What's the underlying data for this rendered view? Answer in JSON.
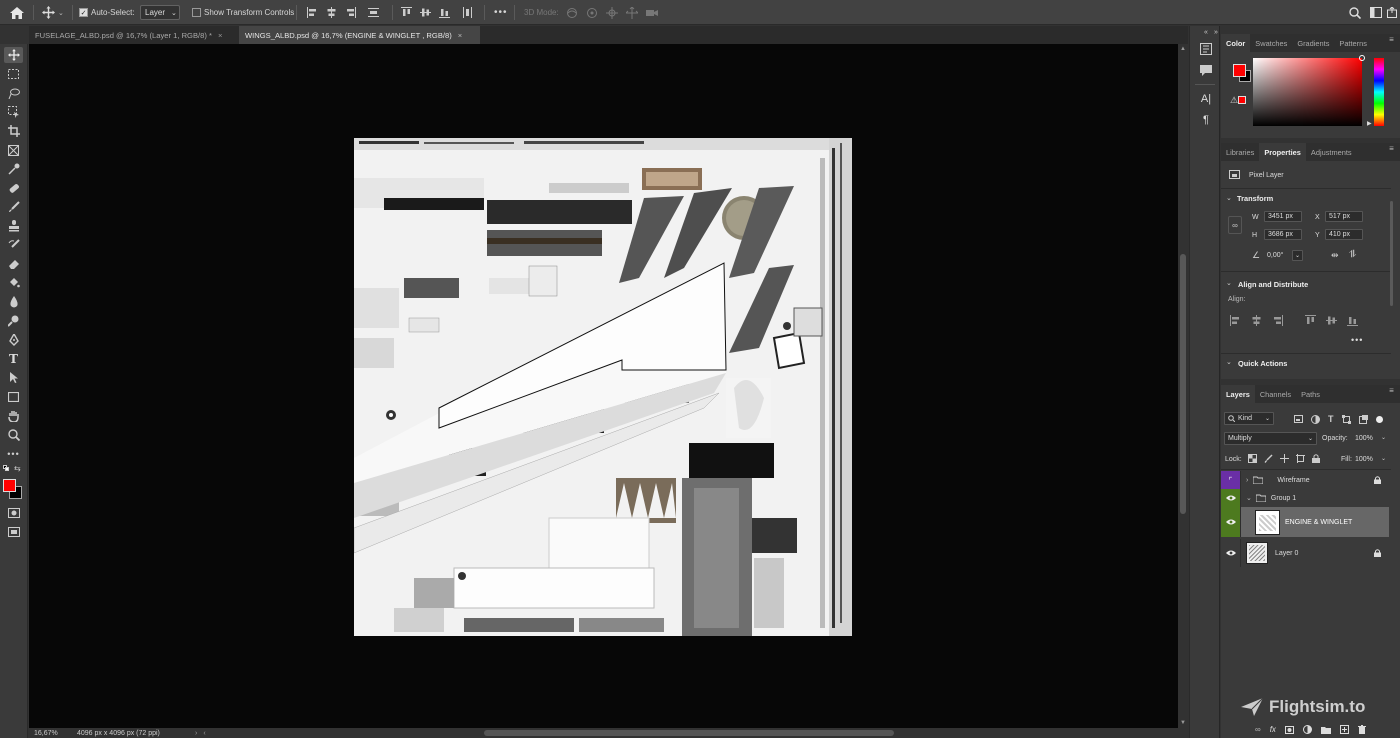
{
  "options_bar": {
    "auto_select_label": "Auto-Select:",
    "auto_select_target": "Layer",
    "show_transform_label": "Show Transform Controls",
    "more_label": "•••",
    "mode_3d_label": "3D Mode:"
  },
  "doc_tabs": [
    {
      "title": "FUSELAGE_ALBD.psd @ 16,7% (Layer 1, RGB/8) *",
      "active": false
    },
    {
      "title": "WINGS_ALBD.psd @ 16,7% (ENGINE & WINGLET , RGB/8)",
      "active": true
    }
  ],
  "status_bar": {
    "zoom": "16,67%",
    "doc_info": "4096 px x 4096 px (72 ppi)"
  },
  "color_panel": {
    "tabs": [
      "Color",
      "Swatches",
      "Gradients",
      "Patterns"
    ],
    "active_tab": "Color",
    "foreground": "#ff0000",
    "background": "#000000"
  },
  "properties_panel": {
    "tabs": [
      "Libraries",
      "Properties",
      "Adjustments"
    ],
    "active_tab": "Properties",
    "layer_type": "Pixel Layer",
    "transform_label": "Transform",
    "w_label": "W",
    "w_value": "3451 px",
    "h_label": "H",
    "h_value": "3686 px",
    "x_label": "X",
    "x_value": "517 px",
    "y_label": "Y",
    "y_value": "410 px",
    "angle_value": "0,00°",
    "align_distribute_label": "Align and Distribute",
    "align_label": "Align:",
    "quick_actions_label": "Quick Actions"
  },
  "layers_panel": {
    "tabs": [
      "Layers",
      "Channels",
      "Paths"
    ],
    "active_tab": "Layers",
    "filter_kind": "Kind",
    "blend_mode": "Multiply",
    "opacity_label": "Opacity:",
    "opacity_value": "100%",
    "lock_label": "Lock:",
    "fill_label": "Fill:",
    "fill_value": "100%",
    "layers": [
      {
        "name": "Wireframe",
        "visible": false,
        "type": "group",
        "locked": true
      },
      {
        "name": "Group 1",
        "visible": true,
        "type": "group",
        "locked": false
      },
      {
        "name": "ENGINE & WINGLET",
        "visible": true,
        "type": "pixel",
        "selected": true
      },
      {
        "name": "Layer 0",
        "visible": true,
        "type": "pixel",
        "locked": true
      }
    ]
  },
  "watermark": "Flightsim.to",
  "colors": {
    "accent_green": "#4d7a1f",
    "accent_purple": "#6a2fa6",
    "foreground_red": "#ff0000"
  }
}
